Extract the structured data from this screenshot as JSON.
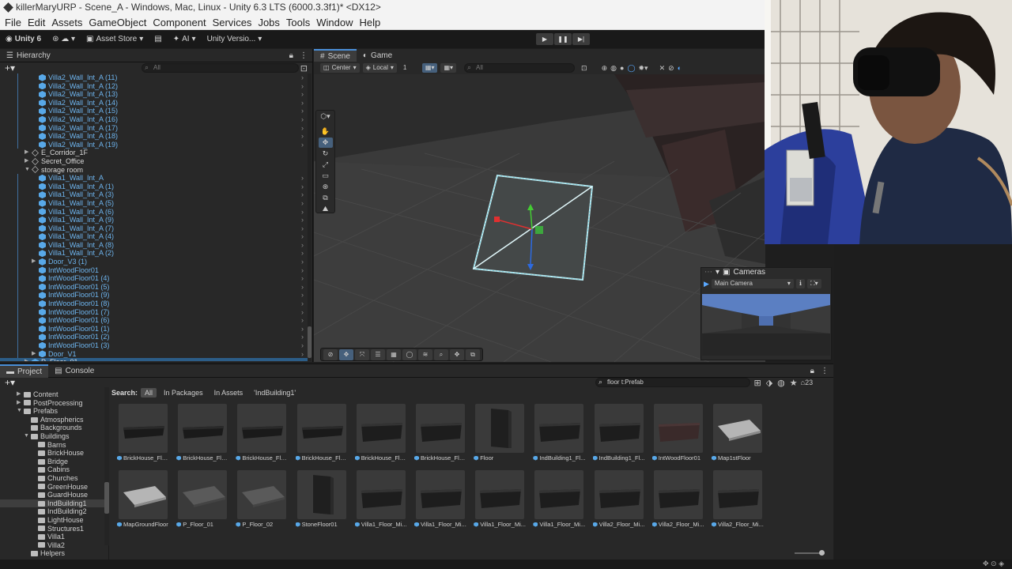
{
  "window": {
    "title": "killerMaryURP - Scene_A - Windows, Mac, Linux - Unity 6.3 LTS (6000.3.3f1)* <DX12>"
  },
  "menu": [
    "File",
    "Edit",
    "Assets",
    "GameObject",
    "Component",
    "Services",
    "Jobs",
    "Tools",
    "Window",
    "Help"
  ],
  "toolbar": {
    "account": "Unity 6",
    "asset_store": "Asset Store",
    "ai": "AI",
    "version_control": "Unity Versio..."
  },
  "hierarchy": {
    "tab": "Hierarchy",
    "search_placeholder": "All",
    "rows": [
      {
        "label": "Villa2_Wall_Int_A (11)",
        "color": "blue",
        "indent": 2,
        "line": true,
        "arrow": ""
      },
      {
        "label": "Villa2_Wall_Int_A (12)",
        "color": "blue",
        "indent": 2,
        "line": true,
        "arrow": ""
      },
      {
        "label": "Villa2_Wall_Int_A (13)",
        "color": "blue",
        "indent": 2,
        "line": true,
        "arrow": ""
      },
      {
        "label": "Villa2_Wall_Int_A (14)",
        "color": "blue",
        "indent": 2,
        "line": true,
        "arrow": ""
      },
      {
        "label": "Villa2_Wall_Int_A (15)",
        "color": "blue",
        "indent": 2,
        "line": true,
        "arrow": ""
      },
      {
        "label": "Villa2_Wall_Int_A (16)",
        "color": "blue",
        "indent": 2,
        "line": true,
        "arrow": ""
      },
      {
        "label": "Villa2_Wall_Int_A (17)",
        "color": "blue",
        "indent": 2,
        "line": true,
        "arrow": ""
      },
      {
        "label": "Villa2_Wall_Int_A (18)",
        "color": "blue",
        "indent": 2,
        "line": true,
        "arrow": ""
      },
      {
        "label": "Villa2_Wall_Int_A (19)",
        "color": "blue",
        "indent": 2,
        "line": true,
        "arrow": ""
      },
      {
        "label": "E_Corridor_1F",
        "color": "white",
        "indent": 1,
        "line": false,
        "arrow": "▶"
      },
      {
        "label": "Secret_Office",
        "color": "white",
        "indent": 1,
        "line": false,
        "arrow": "▶"
      },
      {
        "label": "storage room",
        "color": "white",
        "indent": 1,
        "line": false,
        "arrow": "▼"
      },
      {
        "label": "Villa1_Wall_Int_A",
        "color": "blue",
        "indent": 2,
        "line": true,
        "arrow": ""
      },
      {
        "label": "Villa1_Wall_Int_A (1)",
        "color": "blue",
        "indent": 2,
        "line": true,
        "arrow": ""
      },
      {
        "label": "Villa1_Wall_Int_A (3)",
        "color": "blue",
        "indent": 2,
        "line": true,
        "arrow": ""
      },
      {
        "label": "Villa1_Wall_Int_A (5)",
        "color": "blue",
        "indent": 2,
        "line": true,
        "arrow": ""
      },
      {
        "label": "Villa1_Wall_Int_A (6)",
        "color": "blue",
        "indent": 2,
        "line": true,
        "arrow": ""
      },
      {
        "label": "Villa1_Wall_Int_A (9)",
        "color": "blue",
        "indent": 2,
        "line": true,
        "arrow": ""
      },
      {
        "label": "Villa1_Wall_Int_A (7)",
        "color": "blue",
        "indent": 2,
        "line": true,
        "arrow": ""
      },
      {
        "label": "Villa1_Wall_Int_A (4)",
        "color": "blue",
        "indent": 2,
        "line": true,
        "arrow": ""
      },
      {
        "label": "Villa1_Wall_Int_A (8)",
        "color": "blue",
        "indent": 2,
        "line": true,
        "arrow": ""
      },
      {
        "label": "Villa1_Wall_Int_A (2)",
        "color": "blue",
        "indent": 2,
        "line": true,
        "arrow": ""
      },
      {
        "label": "Door_V3 (1)",
        "color": "blue",
        "indent": 2,
        "line": true,
        "arrow": "▶"
      },
      {
        "label": "IntWoodFloor01",
        "color": "blue",
        "indent": 2,
        "line": true,
        "arrow": ""
      },
      {
        "label": "IntWoodFloor01 (4)",
        "color": "blue",
        "indent": 2,
        "line": true,
        "arrow": ""
      },
      {
        "label": "IntWoodFloor01 (5)",
        "color": "blue",
        "indent": 2,
        "line": true,
        "arrow": ""
      },
      {
        "label": "IntWoodFloor01 (9)",
        "color": "blue",
        "indent": 2,
        "line": true,
        "arrow": ""
      },
      {
        "label": "IntWoodFloor01 (8)",
        "color": "blue",
        "indent": 2,
        "line": true,
        "arrow": ""
      },
      {
        "label": "IntWoodFloor01 (7)",
        "color": "blue",
        "indent": 2,
        "line": true,
        "arrow": ""
      },
      {
        "label": "IntWoodFloor01 (6)",
        "color": "blue",
        "indent": 2,
        "line": true,
        "arrow": ""
      },
      {
        "label": "IntWoodFloor01 (1)",
        "color": "blue",
        "indent": 2,
        "line": true,
        "arrow": ""
      },
      {
        "label": "IntWoodFloor01 (2)",
        "color": "blue",
        "indent": 2,
        "line": true,
        "arrow": ""
      },
      {
        "label": "IntWoodFloor01 (3)",
        "color": "blue",
        "indent": 2,
        "line": true,
        "arrow": ""
      },
      {
        "label": "Door_V1",
        "color": "blue",
        "indent": 2,
        "line": true,
        "arrow": "▶"
      },
      {
        "label": "P_Floor_01",
        "color": "white",
        "indent": 1,
        "line": false,
        "arrow": "▶",
        "selected": true
      }
    ]
  },
  "scene": {
    "tab_scene": "Scene",
    "tab_game": "Game",
    "pivot": "Center",
    "space": "Local",
    "grid_step": "1",
    "search_placeholder": "All"
  },
  "cameras": {
    "title": "Cameras",
    "selected": "Main Camera"
  },
  "project": {
    "tab_project": "Project",
    "tab_console": "Console",
    "search_value": "floor t:Prefab",
    "count": "23",
    "search_label": "Search:",
    "scopes": [
      "All",
      "In Packages",
      "In Assets",
      "'IndBuilding1'"
    ],
    "tree": [
      {
        "label": "Content",
        "indent": 1,
        "arrow": "▶"
      },
      {
        "label": "PostProcessing",
        "indent": 1,
        "arrow": "▶"
      },
      {
        "label": "Prefabs",
        "indent": 1,
        "arrow": "▼"
      },
      {
        "label": "Atmospherics",
        "indent": 2,
        "arrow": ""
      },
      {
        "label": "Backgrounds",
        "indent": 2,
        "arrow": ""
      },
      {
        "label": "Buildings",
        "indent": 2,
        "arrow": "▼"
      },
      {
        "label": "Barns",
        "indent": 3,
        "arrow": ""
      },
      {
        "label": "BrickHouse",
        "indent": 3,
        "arrow": ""
      },
      {
        "label": "Bridge",
        "indent": 3,
        "arrow": ""
      },
      {
        "label": "Cabins",
        "indent": 3,
        "arrow": ""
      },
      {
        "label": "Churches",
        "indent": 3,
        "arrow": ""
      },
      {
        "label": "GreenHouse",
        "indent": 3,
        "arrow": ""
      },
      {
        "label": "GuardHouse",
        "indent": 3,
        "arrow": ""
      },
      {
        "label": "IndBuilding1",
        "indent": 3,
        "arrow": "",
        "selected": true
      },
      {
        "label": "IndBuilding2",
        "indent": 3,
        "arrow": ""
      },
      {
        "label": "LightHouse",
        "indent": 3,
        "arrow": ""
      },
      {
        "label": "Structures1",
        "indent": 3,
        "arrow": ""
      },
      {
        "label": "Villa1",
        "indent": 3,
        "arrow": ""
      },
      {
        "label": "Villa2",
        "indent": 3,
        "arrow": ""
      },
      {
        "label": "Helpers",
        "indent": 2,
        "arrow": ""
      }
    ],
    "assets": [
      {
        "label": "BrickHouse_Flo...",
        "thumb": "slab"
      },
      {
        "label": "BrickHouse_Flo...",
        "thumb": "slab"
      },
      {
        "label": "BrickHouse_Flo...",
        "thumb": "slab"
      },
      {
        "label": "BrickHouse_Flo...",
        "thumb": "slab"
      },
      {
        "label": "BrickHouse_Flo...",
        "thumb": "tile"
      },
      {
        "label": "BrickHouse_Flo...",
        "thumb": "tile"
      },
      {
        "label": "Floor",
        "thumb": "wall"
      },
      {
        "label": "IndBuilding1_Fl...",
        "thumb": "tile"
      },
      {
        "label": "IndBuilding1_Fl...",
        "thumb": "tile"
      },
      {
        "label": "IntWoodFloor01",
        "thumb": "wood"
      },
      {
        "label": "Map1stFloor",
        "thumb": "light"
      },
      {
        "label": "MapGroundFloor",
        "thumb": "light"
      },
      {
        "label": "P_Floor_01",
        "thumb": "grey"
      },
      {
        "label": "P_Floor_02",
        "thumb": "grey"
      },
      {
        "label": "StoneFloor01",
        "thumb": "wall"
      },
      {
        "label": "Villa1_Floor_Mi...",
        "thumb": "tile"
      },
      {
        "label": "Villa1_Floor_Mi...",
        "thumb": "tile"
      },
      {
        "label": "Villa1_Floor_Mi...",
        "thumb": "tile"
      },
      {
        "label": "Villa1_Floor_Mi...",
        "thumb": "tile"
      },
      {
        "label": "Villa2_Floor_Mi...",
        "thumb": "tile"
      },
      {
        "label": "Villa2_Floor_Mi...",
        "thumb": "tile"
      },
      {
        "label": "Villa2_Floor_Mi...",
        "thumb": "tile"
      }
    ]
  },
  "colors": {
    "accent": "#4a8fd8",
    "prefab_blue": "#6eb5ef",
    "panel": "#282828",
    "toolbar": "#191919"
  }
}
